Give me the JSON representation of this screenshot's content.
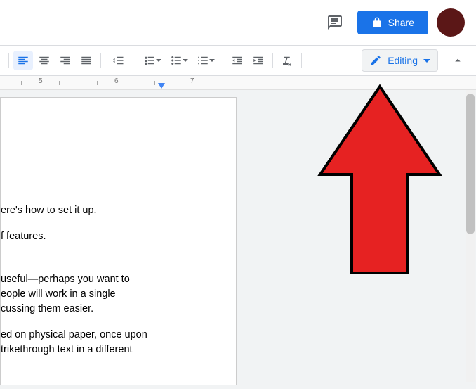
{
  "header": {
    "share_label": "Share"
  },
  "toolbar": {
    "editing_label": "Editing"
  },
  "ruler": {
    "marks": [
      "5",
      "6",
      "7"
    ]
  },
  "document": {
    "p1": "ere's how to set it up.",
    "p2": "f features.",
    "p3": "useful—perhaps you want to\neople will work in a single\ncussing them easier.",
    "p4": "ed on physical paper, once upon\ntrikethrough text in a different"
  }
}
